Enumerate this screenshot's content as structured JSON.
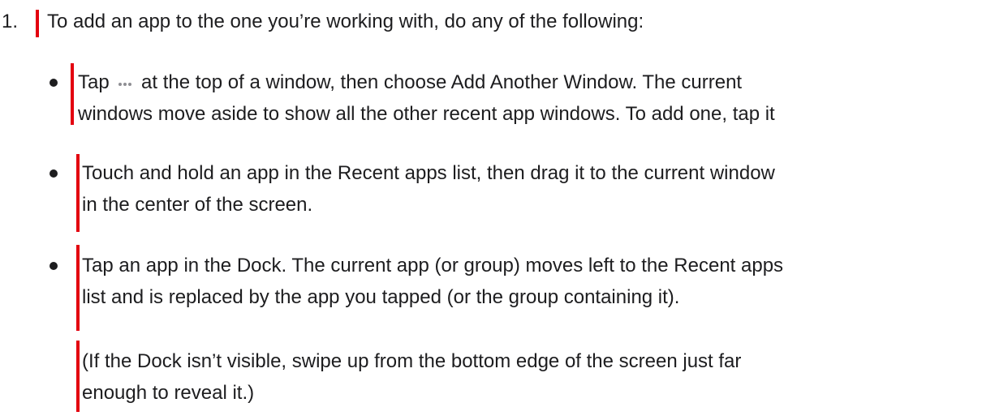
{
  "step": {
    "number": "1.",
    "text": "To add an app to the one you’re working with, do any of the following:"
  },
  "bullets": [
    {
      "before_icon": "Tap",
      "icon": "more-icon",
      "line1_after_icon": "at the top of a window, then choose Add Another Window. The current",
      "line2": "windows move aside to show all the other recent app windows. To add one, tap it"
    },
    {
      "line1": "Touch and hold an app in the Recent apps list, then drag it to the current window",
      "line2": "in the center of the screen."
    },
    {
      "line1": "Tap an app in the Dock. The current app (or group) moves left to the Recent apps",
      "line2": "list and is replaced by the app you tapped (or the group containing it)."
    }
  ],
  "note": {
    "line1": "(If the Dock isn’t visible, swipe up from the bottom edge of the screen just far",
    "line2": "enough to reveal it.)"
  },
  "colors": {
    "text": "#1d1d1f",
    "marker": "#e3000f",
    "icon": "#8e8e93"
  }
}
